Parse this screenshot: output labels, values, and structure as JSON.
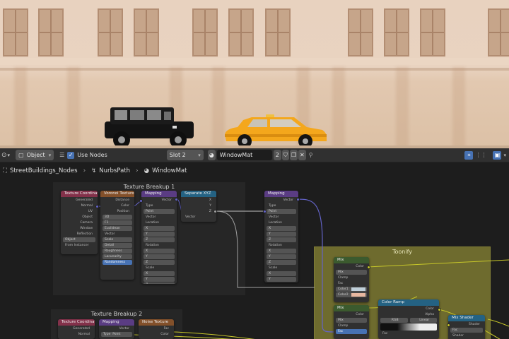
{
  "header": {
    "editor_type_icon": "node-editor-icon",
    "object_mode": "Object",
    "use_nodes_label": "Use Nodes",
    "use_nodes_checked": true,
    "slot": "Slot 2",
    "material_name": "WindowMat",
    "user_count": "2"
  },
  "breadcrumb": {
    "items": [
      "StreetBuildings_Nodes",
      "NurbsPath",
      "WindowMat"
    ]
  },
  "frames": {
    "breakup1": "Texture Breakup 1",
    "breakup2": "Texture Breakup 2",
    "toonify": "Toonify"
  },
  "nodes": {
    "texcoord1": {
      "title": "Texture Coordinate",
      "rows": [
        "Generated",
        "Normal",
        "UV",
        "Object",
        "Camera",
        "Window",
        "Reflection",
        "Object",
        "From Instancer"
      ]
    },
    "voronoi": {
      "title": "Voronoi Texture",
      "rows": [
        "Distance",
        "Color",
        "Position",
        "3D",
        "F1",
        "Euclidean",
        "Vector",
        "Scale",
        "Detail",
        "Roughness",
        "Lacunarity",
        "Randomness"
      ]
    },
    "mapping1": {
      "title": "Mapping",
      "rows": [
        "Vector",
        "Type",
        "Point",
        "Vector",
        "Location",
        "X",
        "Y",
        "Z",
        "Rotation",
        "X",
        "Y",
        "Z",
        "Scale",
        "X",
        "Y",
        "Z"
      ]
    },
    "musgrave": {
      "title": "Separate XYZ",
      "rows": [
        "X",
        "Y",
        "Z",
        "Vector"
      ]
    },
    "mapping2": {
      "title": "Mapping",
      "rows": [
        "Vector",
        "Type",
        "Point",
        "Vector",
        "Location",
        "X",
        "Y",
        "Z",
        "Rotation",
        "X",
        "Y",
        "Z",
        "Scale",
        "X",
        "Y",
        "Z"
      ]
    },
    "mix1": {
      "title": "Mix",
      "rows": [
        "Color",
        "Mix",
        "Clamp",
        "Fac",
        "Color1",
        "Color2"
      ]
    },
    "mix2": {
      "title": "Mix",
      "rows": [
        "Color",
        "Mix",
        "Clamp",
        "Fac"
      ]
    },
    "colorramp": {
      "title": "Color Ramp",
      "rows": [
        "Color",
        "Alpha",
        "RGB",
        "Linear",
        "Fac"
      ]
    },
    "shader": {
      "title": "Mix Shader",
      "rows": [
        "Shader",
        "Fac",
        "Shader",
        "Shader"
      ]
    },
    "texcoord2": {
      "title": "Texture Coordinate",
      "rows": [
        "Generated",
        "Normal"
      ]
    },
    "mapping3": {
      "title": "Mapping",
      "rows": [
        "Vector",
        "Type",
        "Point"
      ]
    },
    "noise": {
      "title": "Noise Texture",
      "rows": [
        "Fac",
        "Color"
      ]
    }
  },
  "colors": {
    "editor_bg": "#1d1d1d",
    "frame_bg": "#262626",
    "toonify_frame": "#6e6b2e",
    "accent_blue": "#4772b3",
    "link_yellow": "#c7c729",
    "link_purple": "#6363c7",
    "link_gray": "#a1a1a1"
  }
}
